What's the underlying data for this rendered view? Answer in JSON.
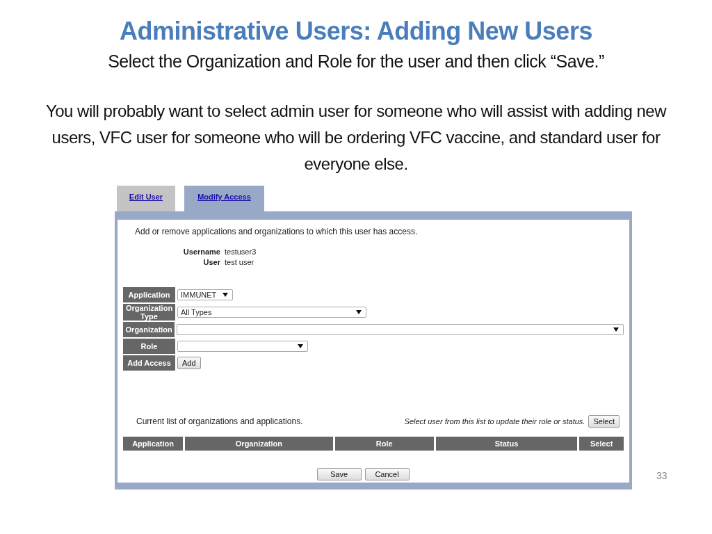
{
  "slide": {
    "title": "Administrative Users: Adding New Users",
    "subtitle": "Select the Organization and Role for the user and then click “Save.”",
    "paragraph": "You will probably want to select admin user for someone who will assist with adding new users, VFC user for someone who will be ordering VFC vaccine, and standard user for everyone else.",
    "page_number": "33"
  },
  "tabs": [
    {
      "label": "Edit User",
      "selected": false
    },
    {
      "label": "Modify Access",
      "selected": true
    }
  ],
  "intro": "Add or remove applications and organizations to which this user has access.",
  "user_info": [
    {
      "label": "Username",
      "value": "testuser3"
    },
    {
      "label": "User",
      "value": "test user"
    }
  ],
  "form_rows": [
    {
      "label": "Application",
      "kind": "select",
      "value": "IMMUNET"
    },
    {
      "label": "Organization Type",
      "kind": "select",
      "value": "All Types"
    },
    {
      "label": "Organization",
      "kind": "select"
    },
    {
      "label": "Role",
      "kind": "select"
    },
    {
      "label": "Add Access",
      "kind": "button",
      "value": "Add"
    }
  ],
  "list_caption": "Current list of organizations and applications.",
  "select_hint": "Select user from this list to update their role or status.",
  "select_button": "Select",
  "table": {
    "columns": [
      "Application",
      "Organization",
      "Role",
      "Status",
      "Select"
    ]
  },
  "buttons": [
    "Save",
    "Cancel"
  ]
}
